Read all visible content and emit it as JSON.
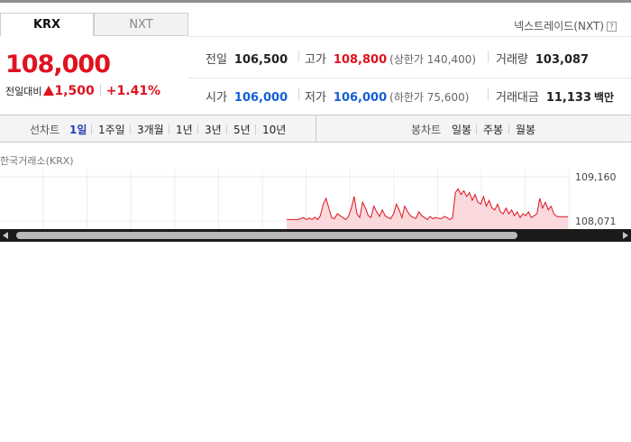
{
  "tabs": {
    "krx": "KRX",
    "nxt": "NXT"
  },
  "nxt_link": "넥스트레이드(NXT)",
  "help_glyph": "?",
  "price": {
    "current": "108,000",
    "change_label": "전일대비",
    "change": "1,500",
    "change_pct": "+1.41%"
  },
  "stats": {
    "prev_close": {
      "label": "전일",
      "value": "106,500"
    },
    "high": {
      "label": "고가",
      "value": "108,800",
      "limit": "(상한가 140,400)"
    },
    "volume": {
      "label": "거래량",
      "value": "103,087"
    },
    "open": {
      "label": "시가",
      "value": "106,000"
    },
    "low": {
      "label": "저가",
      "value": "106,000",
      "limit": "(하한가 75,600)"
    },
    "amount": {
      "label": "거래대금",
      "value": "11,133",
      "unit": "백만"
    }
  },
  "periods": {
    "label": "선차트",
    "items": [
      "1일",
      "1주일",
      "3개월",
      "1년",
      "3년",
      "5년",
      "10년"
    ],
    "selected": "1일"
  },
  "candle": {
    "label": "봉차트",
    "items": [
      "일봉",
      "주봉",
      "월봉"
    ]
  },
  "chart_source": "한국거래소(KRX)",
  "colors": {
    "up": "#e0121f",
    "down": "#1560d6",
    "accent": "#2440b3"
  },
  "chart_data": {
    "type": "line",
    "ylim": [
      107750,
      109300
    ],
    "y_ticks": [
      "109,160",
      "108,071"
    ],
    "series_values": [
      108000,
      108000,
      108000,
      108000,
      108000,
      108020,
      108050,
      108000,
      108040,
      108000,
      108060,
      108000,
      108100,
      108400,
      108550,
      108300,
      108050,
      108020,
      108150,
      108100,
      108050,
      108000,
      108080,
      108300,
      108600,
      108150,
      108050,
      108450,
      108300,
      108100,
      108050,
      108350,
      108200,
      108080,
      108250,
      108100,
      108050,
      108020,
      108150,
      108400,
      108250,
      108050,
      108350,
      108200,
      108100,
      108050,
      108030,
      108200,
      108100,
      108050,
      108000,
      108080,
      108020,
      108050,
      108030,
      108020,
      108080,
      108050,
      108000,
      108050,
      108700,
      108800,
      108650,
      108750,
      108600,
      108700,
      108500,
      108650,
      108450,
      108400,
      108600,
      108350,
      108500,
      108300,
      108250,
      108400,
      108200,
      108150,
      108300,
      108150,
      108250,
      108100,
      108200,
      108050,
      108150,
      108100,
      108200,
      108050,
      108100,
      108150,
      108550,
      108300,
      108450,
      108250,
      108350,
      108150,
      108080,
      108071,
      108071,
      108071,
      108071
    ]
  }
}
